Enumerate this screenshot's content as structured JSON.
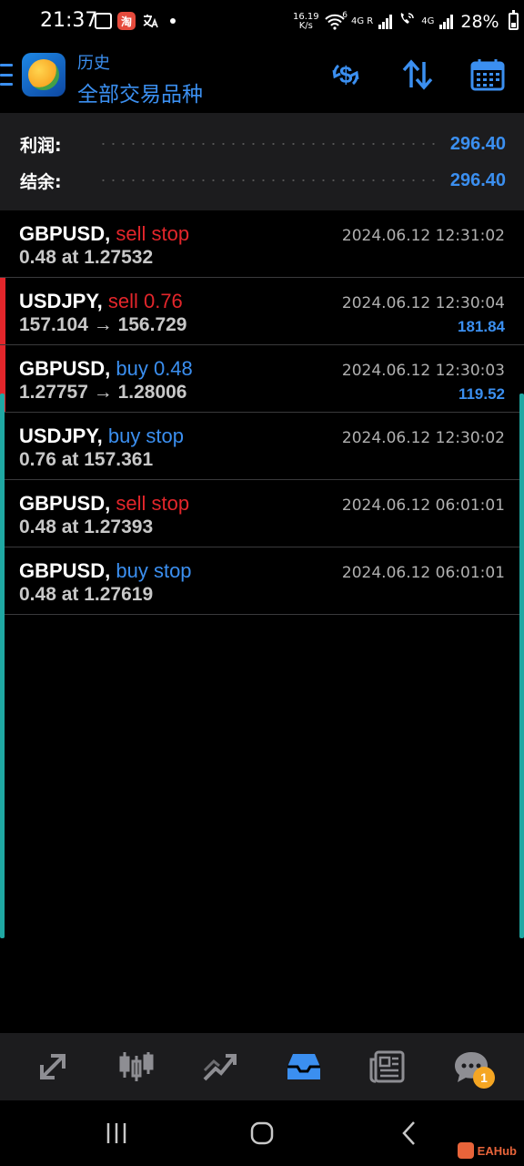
{
  "status_bar": {
    "time": "21:37",
    "app_badge": "淘",
    "network_speed_value": "16.19",
    "network_speed_unit": "K/s",
    "wifi_label": "6",
    "sim1_label": "4G R",
    "sim2_label": "4G",
    "battery": "28%"
  },
  "header": {
    "subtitle": "历史",
    "title": "全部交易品种"
  },
  "summary": {
    "profit_label": "利润:",
    "profit_value": "296.40",
    "balance_label": "结余:",
    "balance_value": "296.40"
  },
  "orders": [
    {
      "symbol": "GBPUSD,",
      "action": "sell stop",
      "side": "sell",
      "detail": "0.48 at 1.27532",
      "time": "2024.06.12 12:31:02",
      "profit": "",
      "flag": false
    },
    {
      "symbol": "USDJPY,",
      "action": "sell 0.76",
      "side": "sell",
      "detail": "157.104 → 156.729",
      "time": "2024.06.12 12:30:04",
      "profit": "181.84",
      "flag": true
    },
    {
      "symbol": "GBPUSD,",
      "action": "buy 0.48",
      "side": "buy",
      "detail": "1.27757 → 1.28006",
      "time": "2024.06.12 12:30:03",
      "profit": "119.52",
      "flag": true
    },
    {
      "symbol": "USDJPY,",
      "action": "buy stop",
      "side": "buy",
      "detail": "0.76 at 157.361",
      "time": "2024.06.12 12:30:02",
      "profit": "",
      "flag": false
    },
    {
      "symbol": "GBPUSD,",
      "action": "sell stop",
      "side": "sell",
      "detail": "0.48 at 1.27393",
      "time": "2024.06.12 06:01:01",
      "profit": "",
      "flag": false
    },
    {
      "symbol": "GBPUSD,",
      "action": "buy stop",
      "side": "buy",
      "detail": "0.48 at 1.27619",
      "time": "2024.06.12 06:01:01",
      "profit": "",
      "flag": false
    }
  ],
  "bottom_nav": {
    "items": [
      "quotes-icon",
      "chart-icon",
      "trade-icon",
      "history-icon",
      "news-icon",
      "chat-icon"
    ],
    "active": "history-icon",
    "chat_badge": "1"
  },
  "watermark": "EAHub",
  "colors": {
    "accent": "#3b8ff0",
    "sell": "#e3262b",
    "buy": "#3b8ff0",
    "edge": "#1fa8a3"
  }
}
